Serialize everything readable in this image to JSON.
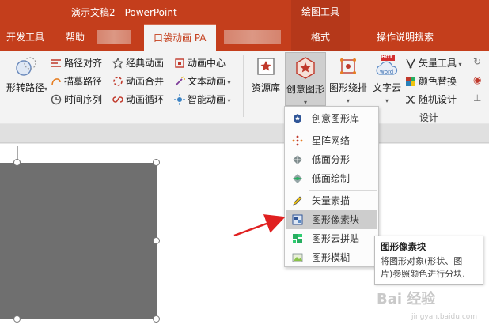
{
  "window": {
    "title": "演示文稿2  -  PowerPoint",
    "context_group": "绘图工具"
  },
  "tabs": {
    "dev": "开发工具",
    "help": "帮助",
    "pocket": "口袋动画 PA",
    "format": "格式",
    "tell_me": "操作说明搜索"
  },
  "ribbon": {
    "left_big": "形转路径",
    "path_align": "路径对齐",
    "trace_path": "描摹路径",
    "timeline": "时间序列",
    "classic_anim": "经典动画",
    "anim_merge": "动画合并",
    "anim_loop": "动画循环",
    "anim_center": "动画中心",
    "text_anim": "文本动画",
    "smart_anim": "智能动画",
    "resource_lib": "资源库",
    "creative_shape": "创意图形",
    "shape_layout": "图形绕排",
    "word_cloud": "文字云",
    "hot_badge": "HOT",
    "word_badge": "word",
    "vector_tools": "矢量工具",
    "color_replace": "颜色替换",
    "random_design": "随机设计",
    "design_group": "设计"
  },
  "menu": {
    "items": [
      "创意图形库",
      "星阵网络",
      "低面分形",
      "低面绘制",
      "矢量素描",
      "图形像素块",
      "图形云拼贴",
      "图形模糊"
    ]
  },
  "tooltip": {
    "title": "图形像素块",
    "line1": "将图形对象(形状、图",
    "line2": "片)参照颜色进行分块."
  },
  "watermark": {
    "text": "Bai 经验",
    "sub": "jingyan.baidu.com"
  },
  "colors": {
    "accent": "#c43e1c",
    "arrow": "#e02020"
  }
}
